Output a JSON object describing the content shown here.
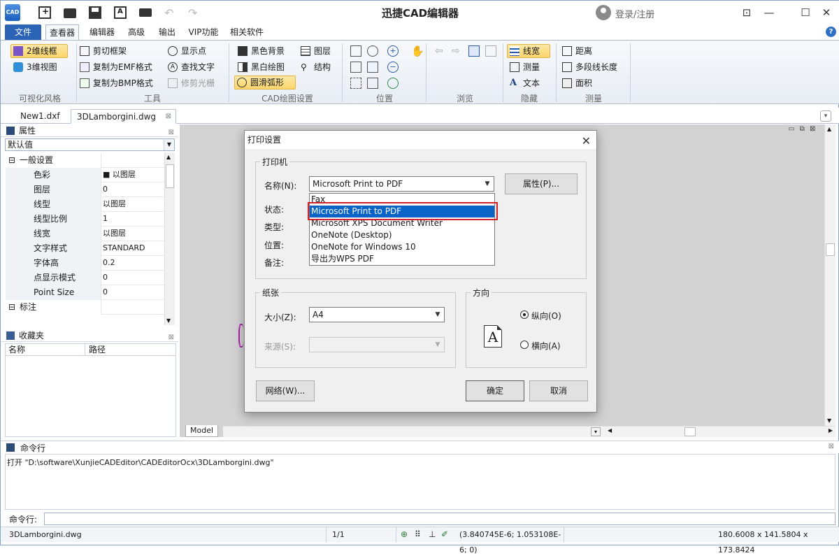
{
  "app": {
    "title": "迅捷CAD编辑器",
    "logo_text": "CAD",
    "login": "登录/注册"
  },
  "window": {
    "min": "—",
    "max": "☐",
    "close": "✕",
    "feedback": "⊡"
  },
  "ribbon_tabs": [
    "文件",
    "查看器",
    "编辑器",
    "高级",
    "输出",
    "VIP功能",
    "相关软件"
  ],
  "ribbon": {
    "visual": {
      "btn1": "2维线框",
      "btn2": "3维视图",
      "label": "可视化风格"
    },
    "tools": {
      "clip": "剪切框架",
      "emf": "复制为EMF格式",
      "bmp": "复制为BMP格式",
      "points": "显示点",
      "find": "查找文字",
      "raster": "修剪光栅",
      "label": "工具"
    },
    "draw": {
      "black_bg": "黑色背景",
      "bw": "黑白绘图",
      "smooth": "圆滑弧形",
      "layers": "图层",
      "structure": "结构",
      "label": "CAD绘图设置"
    },
    "position": {
      "label": "位置"
    },
    "browse": {
      "label": "浏览"
    },
    "hide": {
      "linewidth": "线宽",
      "measure": "测量",
      "text": "文本",
      "label": "隐藏"
    },
    "measure": {
      "distance": "距离",
      "polylen": "多段线长度",
      "area": "面积",
      "label": "测量"
    }
  },
  "doc_tabs": [
    "New1.dxf",
    "3DLamborgini.dwg"
  ],
  "properties": {
    "title": "属性",
    "combo": "默认值",
    "rows": [
      {
        "name": "一般设置",
        "value": "",
        "group": true,
        "toggle": "⊟"
      },
      {
        "name": "色彩",
        "value": "■ 以图层"
      },
      {
        "name": "图层",
        "value": "0"
      },
      {
        "name": "线型",
        "value": "以图层"
      },
      {
        "name": "线型比例",
        "value": "1"
      },
      {
        "name": "线宽",
        "value": "以图层"
      },
      {
        "name": "文字样式",
        "value": "STANDARD"
      },
      {
        "name": "字体高",
        "value": "0.2"
      },
      {
        "name": "点显示模式",
        "value": "0"
      },
      {
        "name": "Point Size",
        "value": "0"
      },
      {
        "name": "标注",
        "value": "",
        "group": true,
        "toggle": "⊟"
      }
    ]
  },
  "favorites": {
    "title": "收藏夹",
    "col_name": "名称",
    "col_path": "路径"
  },
  "canvas": {
    "model_tab": "Model"
  },
  "command": {
    "title": "命令行",
    "log": "打开 \"D:\\software\\XunjieCADEditor\\CADEditorOcx\\3DLamborgini.dwg\"",
    "prompt": "命令行:"
  },
  "status": {
    "file": "3DLamborgini.dwg",
    "page": "1/1",
    "coords": "(3.840745E-6; 1.053108E-6; 0)",
    "dims": "180.6008 x 141.5804 x 173.8424"
  },
  "dialog": {
    "title": "打印设置",
    "printer_group": "打印机",
    "name_label": "名称(N):",
    "name_value": "Microsoft Print to PDF",
    "properties_btn": "属性(P)...",
    "status_label": "状态:",
    "type_label": "类型:",
    "where_label": "位置:",
    "comment_label": "备注:",
    "printer_options": [
      "Fax",
      "Microsoft Print to PDF",
      "Microsoft XPS Document Writer",
      "OneNote (Desktop)",
      "OneNote for Windows 10",
      "导出为WPS PDF"
    ],
    "selected_option_index": 1,
    "paper_group": "纸张",
    "size_label": "大小(Z):",
    "size_value": "A4",
    "source_label": "来源(S):",
    "source_value": "",
    "orientation_group": "方向",
    "orientation_icon": "A",
    "portrait": "纵向(O)",
    "landscape": "横向(A)",
    "selected_orientation": "portrait",
    "network_btn": "网络(W)...",
    "ok_btn": "确定",
    "cancel_btn": "取消"
  },
  "colors": {
    "accent": "#2b63b6",
    "selection": "#0a64c8",
    "highlight_box": "#d2232a",
    "ribbon_selected": "#fbd66a"
  }
}
